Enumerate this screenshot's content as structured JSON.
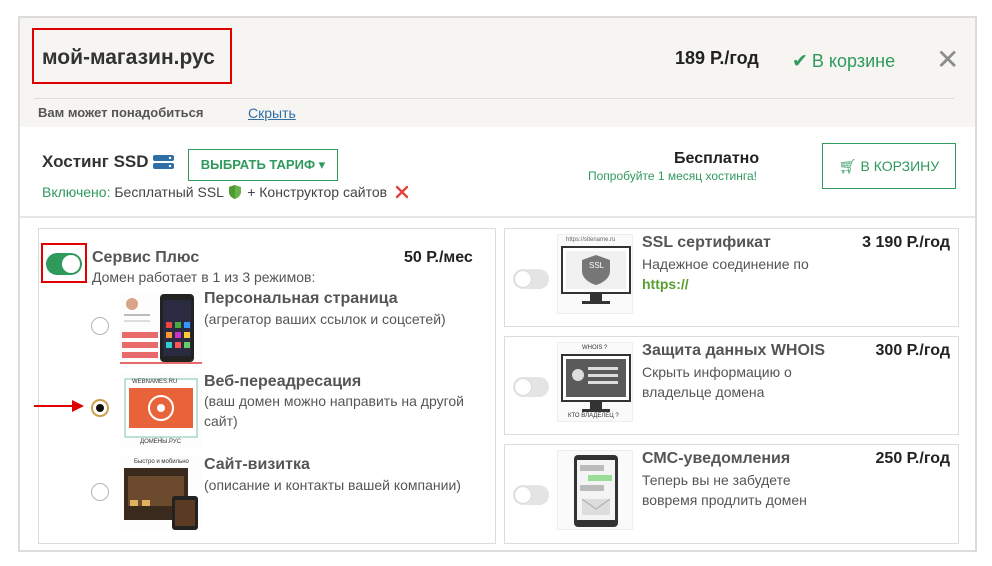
{
  "header": {
    "domain": "мой-магазин.рус",
    "price": "189 Р./год",
    "in_cart": "В корзине",
    "maybe_needed": "Вам может понадобиться",
    "hide": "Скрыть"
  },
  "hosting": {
    "title": "Хостинг SSD",
    "choose_plan": "ВЫБРАТЬ ТАРИФ",
    "included_label": "Включено:",
    "included_text_1": "Бесплатный SSL",
    "included_text_2": "+ Конструктор сайтов",
    "free": "Бесплатно",
    "free_note": "Попробуйте 1 месяц хостинга!",
    "to_cart": "В КОРЗИНУ"
  },
  "service_plus": {
    "title": "Сервис Плюс",
    "price": "50 Р./мес",
    "subtitle": "Домен работает в 1 из 3 режимов:",
    "enabled": true,
    "options": [
      {
        "title": "Персональная страница",
        "desc": "(агрегатор ваших ссылок и соцсетей)",
        "checked": false
      },
      {
        "title": "Веб-переадресация",
        "desc": "(ваш домен можно направить на другой сайт)",
        "checked": true,
        "thumb_top": "WEBNAMES.RU",
        "thumb_bottom": "ДОМЕНЫ.РУС"
      },
      {
        "title": "Сайт-визитка",
        "desc": "(описание и контакты вашей компании)",
        "checked": false,
        "thumb_top": "Быстро и мобильно"
      }
    ]
  },
  "extras": [
    {
      "title": "SSL сертификат",
      "price": "3 190 Р./год",
      "desc": "Надежное соединение по",
      "link": "https://",
      "thumb_url": "https://sitename.ru",
      "thumb_badge": "SSL",
      "enabled": false
    },
    {
      "title": "Защита данных WHOIS",
      "price": "300 Р./год",
      "desc": "Скрыть информацию о владельце домена",
      "thumb_top": "WHOIS ?",
      "thumb_bottom": "КТО ВЛАДЕЛЕЦ ?",
      "enabled": false
    },
    {
      "title": "СМС-уведомления",
      "price": "250 Р./год",
      "desc": "Теперь вы не забудете вовремя продлить домен",
      "enabled": false
    }
  ],
  "colors": {
    "accent": "#2e9a5c",
    "highlight": "#e00000",
    "link": "#2f6fa7"
  }
}
